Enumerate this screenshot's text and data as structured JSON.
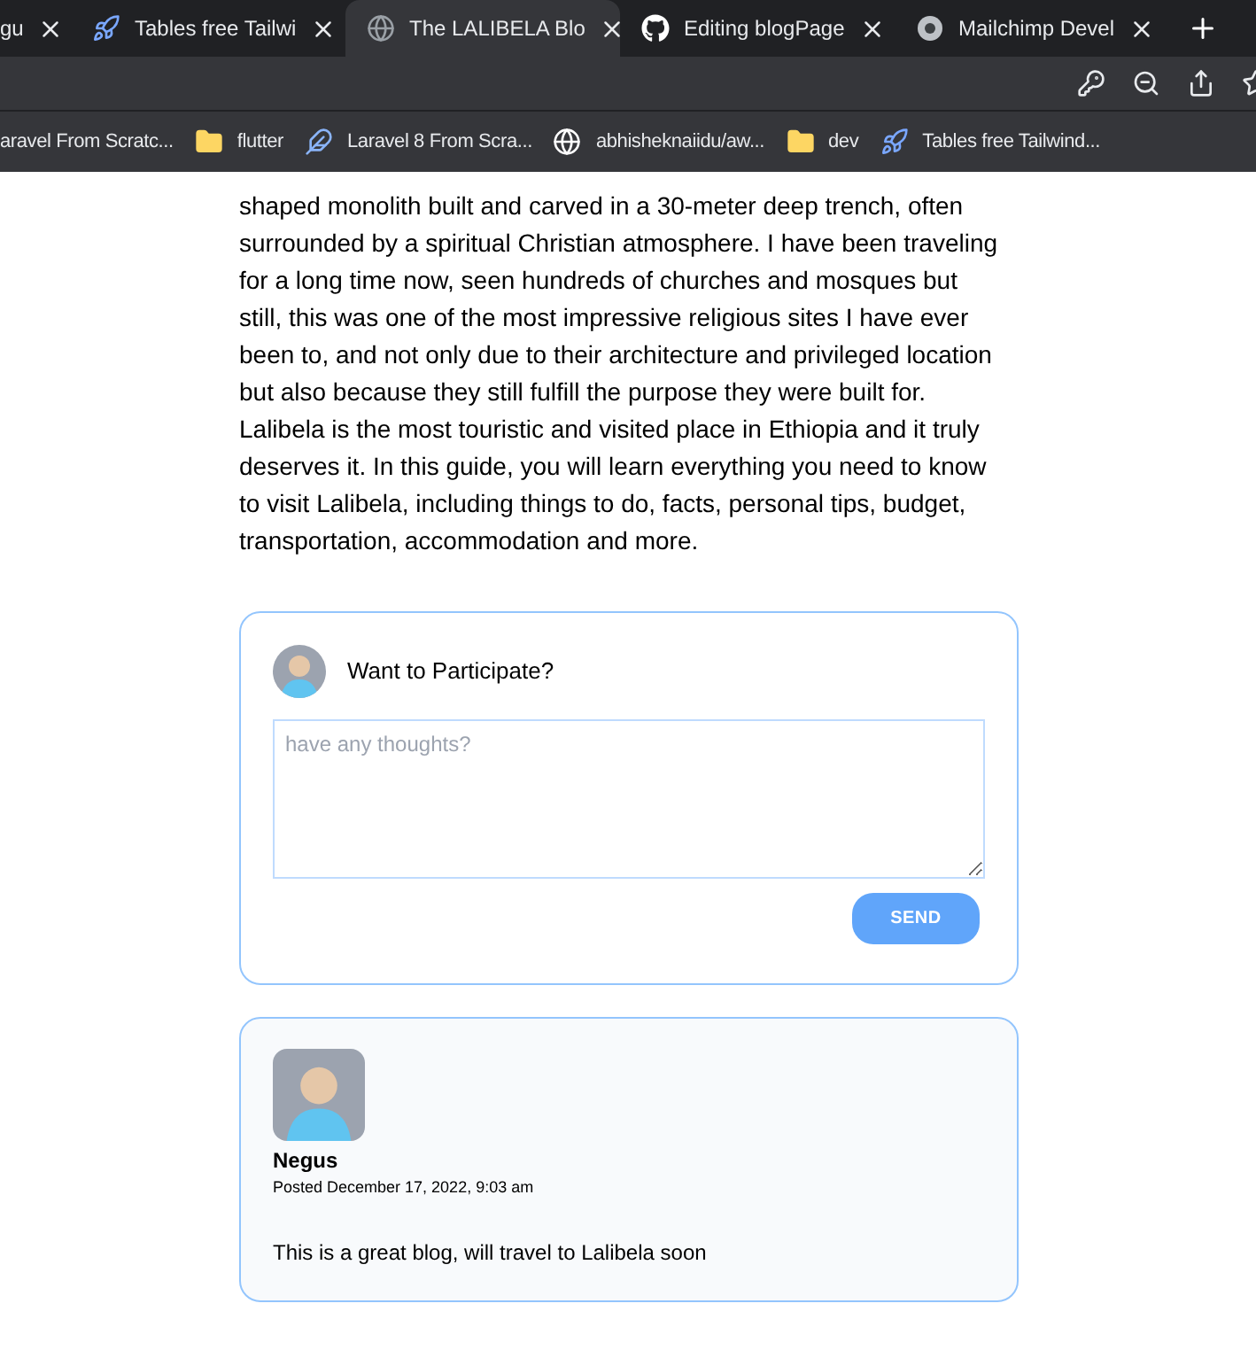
{
  "tabs": [
    {
      "title": "gu",
      "selected": false
    },
    {
      "title": "Tables free Tailwi",
      "selected": false
    },
    {
      "title": "The LALIBELA Blo",
      "selected": true
    },
    {
      "title": "Editing blogPage",
      "selected": false
    },
    {
      "title": "Mailchimp Devel",
      "selected": false
    }
  ],
  "bookmarks": [
    "aravel From Scratc...",
    "flutter",
    "Laravel 8 From Scra...",
    "abhisheknaiidu/aw...",
    "dev",
    "Tables free Tailwind..."
  ],
  "article": {
    "text": "shaped monolith built and carved in a 30-meter deep trench, often surrounded by a spiritual Christian atmosphere. I have been traveling for a long time now, seen hundreds of churches and mosques but still, this was one of the most impressive religious sites I have ever been to, and not only due to their architecture and privileged location but also because they still fulfill the purpose they were built for. Lalibela is the most touristic and visited place in Ethiopia and it truly deserves it. In this guide, you will learn everything you need to know to visit Lalibela, including things to do, facts, personal tips, budget, transportation, accommodation and more."
  },
  "comment_form": {
    "title": "Want to Participate?",
    "placeholder": "have any thoughts?",
    "button": "SEND"
  },
  "comments": [
    {
      "author": "Negus",
      "posted": "Posted December 17, 2022, 9:03 am",
      "text": "This is a great blog, will travel to Lalibela soon"
    }
  ]
}
